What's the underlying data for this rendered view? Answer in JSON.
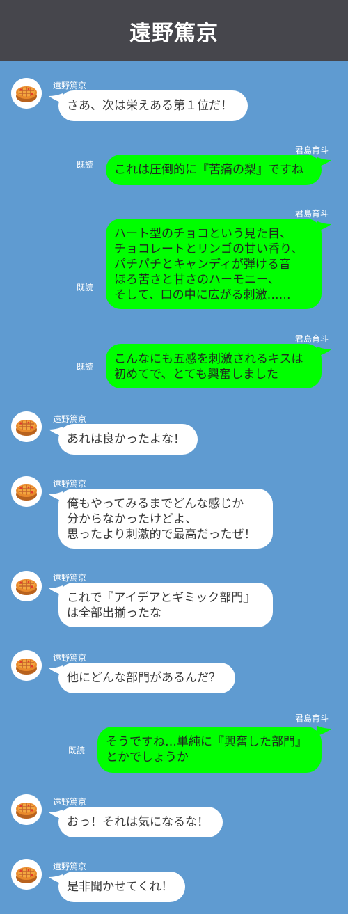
{
  "header": {
    "title": "遠野篤京"
  },
  "read_label": "既読",
  "messages": [
    {
      "sender": "遠野篤京",
      "text": "さあ、次は栄えある第１位だ！"
    },
    {
      "sender": "君島育斗",
      "text": "これは圧倒的に『苦痛の梨』ですね"
    },
    {
      "sender": "君島育斗",
      "text": "ハート型のチョコという見た目、\nチョコレートとリンゴの甘い香り、\nパチパチとキャンディが弾ける音\nほろ苦さと甘さのハーモニー、\nそして、口の中に広がる刺激……"
    },
    {
      "sender": "君島育斗",
      "text": "こんなにも五感を刺激されるキスは\n初めてで、とても興奮しました"
    },
    {
      "sender": "遠野篤京",
      "text": "あれは良かったよな！"
    },
    {
      "sender": "遠野篤京",
      "text": "俺もやってみるまでどんな感じか\n分からなかったけどよ、\n思ったより刺激的で最高だったぜ！"
    },
    {
      "sender": "遠野篤京",
      "text": "これで『アイデアとギミック部門』\nは全部出揃ったな"
    },
    {
      "sender": "遠野篤京",
      "text": "他にどんな部門があるんだ？"
    },
    {
      "sender": "君島育斗",
      "text": "そうですね…単純に『興奮した部門』\nとかでしょうか"
    },
    {
      "sender": "遠野篤京",
      "text": "おっ！それは気になるな！"
    },
    {
      "sender": "遠野篤京",
      "text": "是非聞かせてくれ！"
    }
  ]
}
